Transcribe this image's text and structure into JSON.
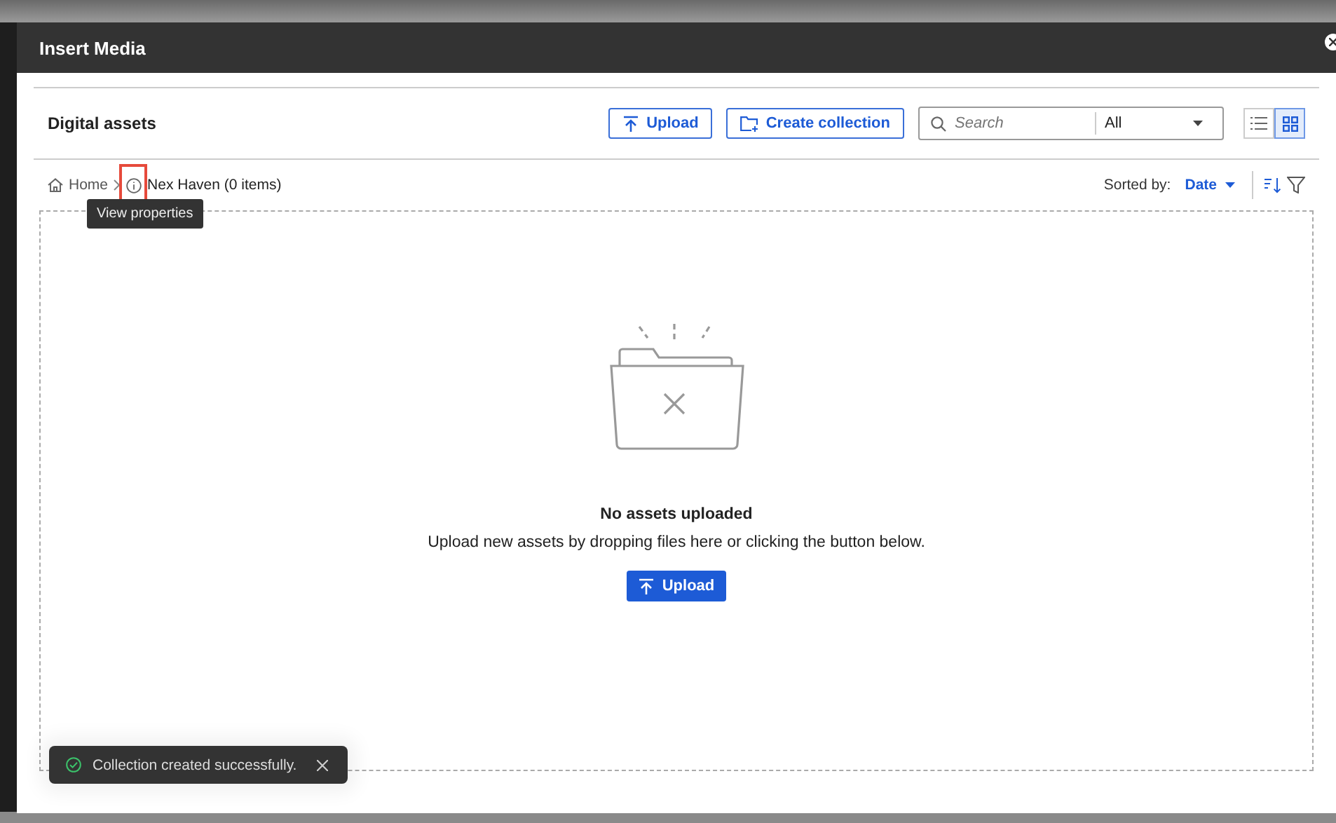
{
  "window": {
    "title": "Insert Media"
  },
  "header": {
    "title": "Digital assets",
    "upload_button": "Upload",
    "create_button": "Create collection",
    "search": {
      "placeholder": "Search"
    },
    "filter": {
      "value": "All"
    },
    "views": [
      {
        "kind": "list",
        "selected": false
      },
      {
        "kind": "grid",
        "selected": true
      }
    ]
  },
  "breadcrumb": {
    "home": "Home",
    "current": "Nex Haven (0 items)"
  },
  "tooltip": "View properties",
  "sort": {
    "label": "Sorted by:",
    "value": "Date"
  },
  "empty_state": {
    "title": "No assets uploaded",
    "message": "Upload new assets by dropping files here or clicking the button below.",
    "button": "Upload"
  },
  "toast": {
    "message": "Collection created successfully."
  }
}
